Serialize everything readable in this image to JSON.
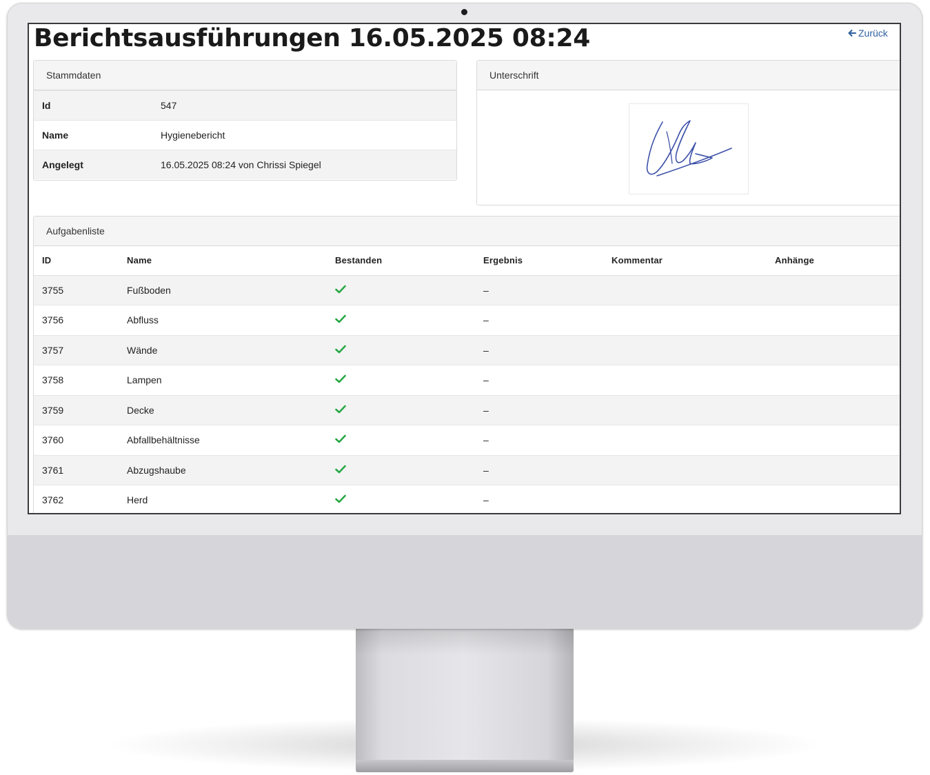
{
  "page": {
    "title": "Berichtsausführungen 16.05.2025 08:24",
    "back_label": "Zurück"
  },
  "stammdaten": {
    "heading": "Stammdaten",
    "rows": [
      {
        "key": "Id",
        "value": "547"
      },
      {
        "key": "Name",
        "value": "Hygienebericht"
      },
      {
        "key": "Angelegt",
        "value": "16.05.2025 08:24 von Chrissi Spiegel"
      }
    ]
  },
  "signature": {
    "heading": "Unterschrift",
    "stroke_color": "#3b4fa8"
  },
  "tasks": {
    "heading": "Aufgabenliste",
    "columns": [
      "ID",
      "Name",
      "Bestanden",
      "Ergebnis",
      "Kommentar",
      "Anhänge"
    ],
    "rows": [
      {
        "id": "3755",
        "name": "Fußboden",
        "passed": true,
        "result": "–",
        "comment": "",
        "attachments": ""
      },
      {
        "id": "3756",
        "name": "Abfluss",
        "passed": true,
        "result": "–",
        "comment": "",
        "attachments": ""
      },
      {
        "id": "3757",
        "name": "Wände",
        "passed": true,
        "result": "–",
        "comment": "",
        "attachments": ""
      },
      {
        "id": "3758",
        "name": "Lampen",
        "passed": true,
        "result": "–",
        "comment": "",
        "attachments": ""
      },
      {
        "id": "3759",
        "name": "Decke",
        "passed": true,
        "result": "–",
        "comment": "",
        "attachments": ""
      },
      {
        "id": "3760",
        "name": "Abfallbehältnisse",
        "passed": true,
        "result": "–",
        "comment": "",
        "attachments": ""
      },
      {
        "id": "3761",
        "name": "Abzugshaube",
        "passed": true,
        "result": "–",
        "comment": "",
        "attachments": ""
      },
      {
        "id": "3762",
        "name": "Herd",
        "passed": true,
        "result": "–",
        "comment": "",
        "attachments": ""
      }
    ]
  },
  "colors": {
    "check": "#28a745",
    "link": "#2d5fa0"
  }
}
